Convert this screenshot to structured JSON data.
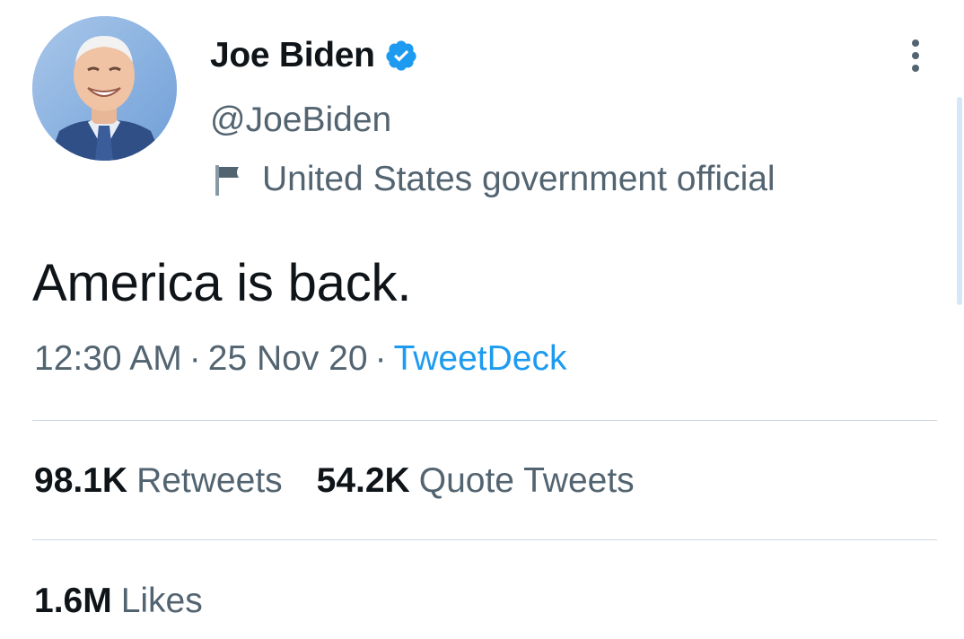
{
  "author": {
    "display_name": "Joe Biden",
    "handle": "@JoeBiden",
    "label": "United States government official",
    "avatar_icon": "avatar-photo",
    "verified_icon": "verified-badge-icon",
    "flag_icon": "flag-icon"
  },
  "tweet": {
    "text": "America is back.",
    "time": "12:30 AM",
    "separator": "·",
    "date": "25 Nov 20",
    "source": "TweetDeck"
  },
  "stats": {
    "retweets": {
      "count": "98.1K",
      "label": "Retweets"
    },
    "quotes": {
      "count": "54.2K",
      "label": "Quote Tweets"
    },
    "likes": {
      "count": "1.6M",
      "label": "Likes"
    }
  },
  "colors": {
    "accent": "#1d9bf0",
    "secondary_text": "#536471",
    "primary_text": "#0f1419",
    "divider": "#cfd9de"
  }
}
